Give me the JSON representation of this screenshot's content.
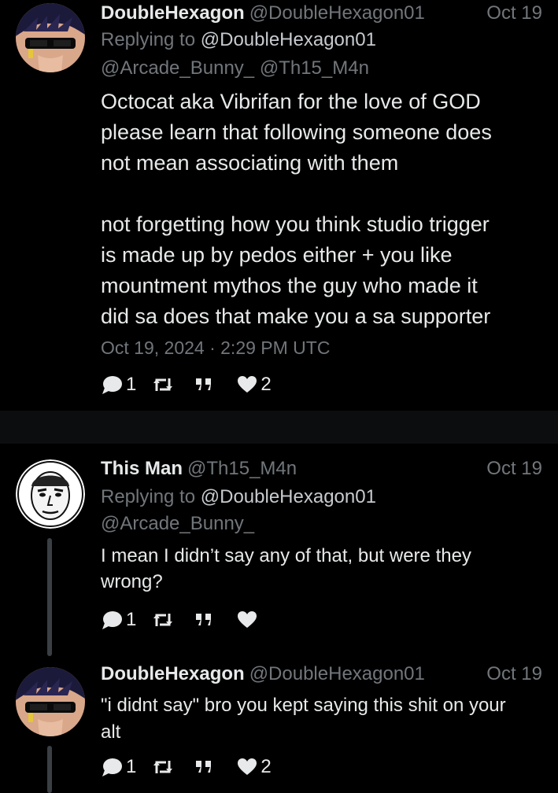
{
  "tweets": [
    {
      "display_name": "DoubleHexagon",
      "handle": "@DoubleHexagon01",
      "date": "Oct 19",
      "replying_label": "Replying to",
      "replying_to": "@DoubleHexagon01",
      "replying_to_more": "@Arcade_Bunny_ @Th15_M4n",
      "text": "Octocat aka Vibrifan for the love of GOD\nplease learn that following someone does\nnot mean associating with them\n\nnot forgetting how you think studio trigger\nis made up by pedos either + you like\nmountment mythos the guy who made it\ndid sa does that make you a sa supporter",
      "timestamp": "Oct 19, 2024 · 2:29 PM UTC",
      "reply_count": "1",
      "retweet_count": "",
      "quote_count": "",
      "like_count": "2"
    },
    {
      "display_name": "This Man",
      "handle": "@Th15_M4n",
      "date": "Oct 19",
      "replying_label": "Replying to",
      "replying_to": "@DoubleHexagon01",
      "replying_to_more": "@Arcade_Bunny_",
      "text": "I mean I didn’t say any of that, but were they\nwrong?",
      "reply_count": "1",
      "retweet_count": "",
      "quote_count": "",
      "like_count": ""
    },
    {
      "display_name": "DoubleHexagon",
      "handle": "@DoubleHexagon01",
      "date": "Oct 19",
      "text": "\"i didnt say\" bro you kept saying this shit on your\nalt",
      "reply_count": "1",
      "retweet_count": "",
      "quote_count": "",
      "like_count": "2"
    }
  ],
  "icons": {
    "reply": "comment-bubble-icon",
    "retweet": "retweet-icon",
    "quote": "quote-icon",
    "like": "heart-icon"
  },
  "colors": {
    "background": "#000000",
    "text": "#e7e9ea",
    "muted": "#71767b"
  }
}
